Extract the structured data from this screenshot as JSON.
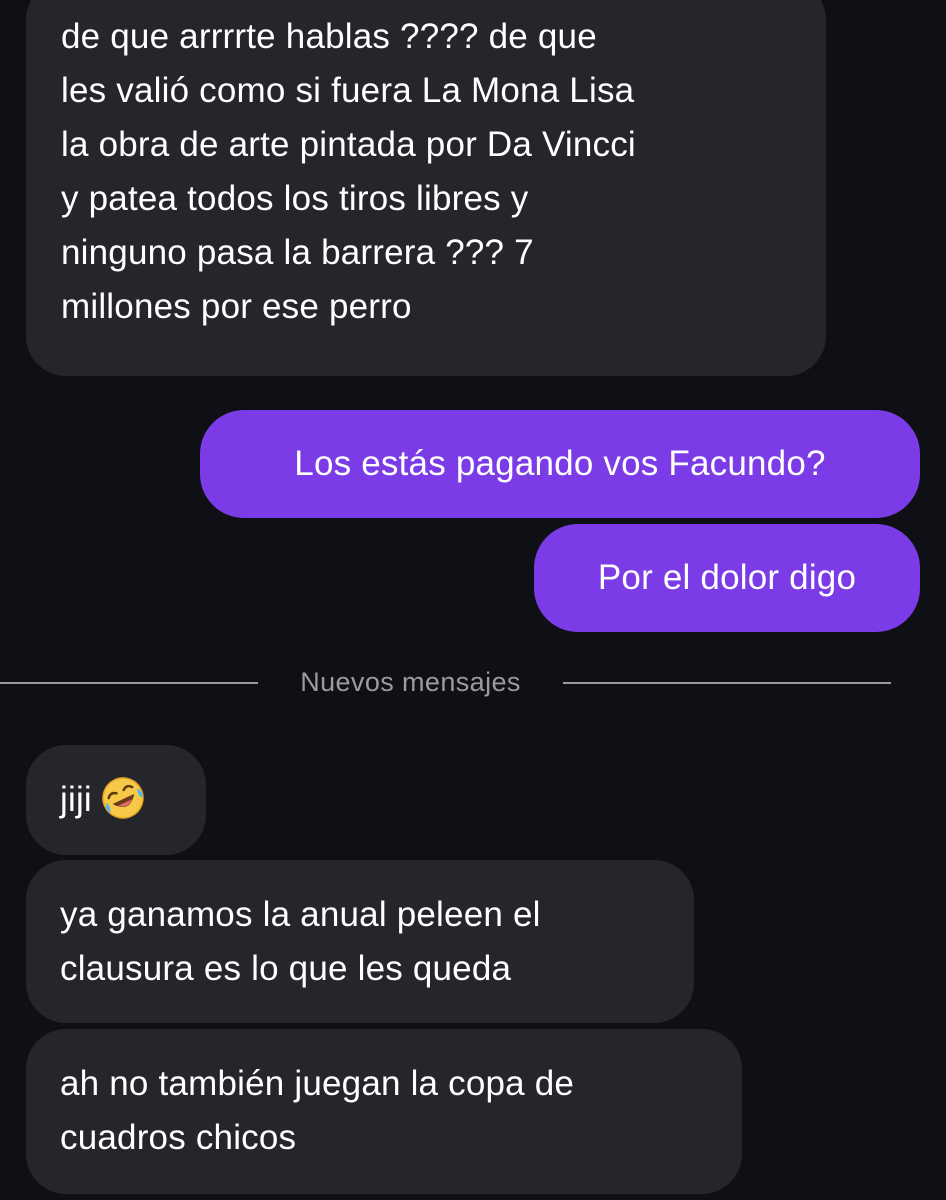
{
  "messages": [
    {
      "id": "msg1",
      "direction": "incoming",
      "text": "de que arrrrte hablas ???? de que\nles valió como si fuera La Mona Lisa\nla obra de arte pintada por Da Vincci\ny patea todos los tiros libres y\nninguno pasa la barrera ??? 7\nmillones por ese perro"
    },
    {
      "id": "msg2",
      "direction": "outgoing",
      "text": "Los estás pagando vos Facundo?"
    },
    {
      "id": "msg3",
      "direction": "outgoing",
      "text": "Por el dolor digo"
    },
    {
      "id": "msg4",
      "direction": "incoming",
      "text": "jiji",
      "emoji": "rolling-on-the-floor-laughing-emoji"
    },
    {
      "id": "msg5",
      "direction": "incoming",
      "text": "ya ganamos la anual peleen el\nclausura es lo que les queda"
    },
    {
      "id": "msg6",
      "direction": "incoming",
      "text": "ah no también juegan la copa de\ncuadros chicos"
    }
  ],
  "divider": {
    "label": "Nuevos mensajes"
  },
  "colors": {
    "background": "#0f1015",
    "incoming_bubble": "#25262b",
    "outgoing_bubble": "#7b3ce8",
    "divider": "#9a9ba0",
    "text": "#ffffff"
  }
}
